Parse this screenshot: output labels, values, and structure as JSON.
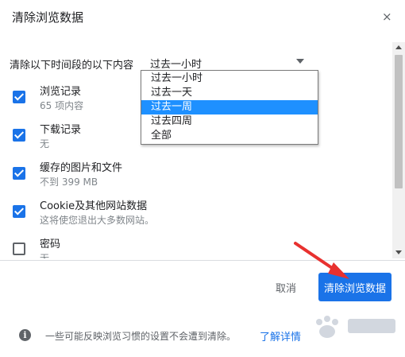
{
  "dialog": {
    "title": "清除浏览数据",
    "close_glyph": "×"
  },
  "time_range": {
    "label": "清除以下时间段的以下内容",
    "selected": "过去一小时",
    "options": [
      "过去一小时",
      "过去一天",
      "过去一周",
      "过去四周",
      "全部"
    ],
    "highlighted_index": 2
  },
  "items": [
    {
      "title": "浏览记录",
      "subtitle": "65 项内容",
      "checked": true
    },
    {
      "title": "下载记录",
      "subtitle": "无",
      "checked": true
    },
    {
      "title": "缓存的图片和文件",
      "subtitle": "不到 399 MB",
      "checked": true
    },
    {
      "title": "Cookie及其他网站数据",
      "subtitle": "这将使您退出大多数网站。",
      "checked": true
    },
    {
      "title": "密码",
      "subtitle": "无",
      "checked": false
    }
  ],
  "footer": {
    "cancel_label": "取消",
    "clear_label": "清除浏览数据",
    "info_text": "一些可能反映浏览习惯的设置不会遭到清除。",
    "learn_more_label": "了解详情"
  },
  "colors": {
    "accent": "#1a73e8",
    "highlight": "#1e90ff",
    "annotation_arrow": "#e8312f"
  }
}
